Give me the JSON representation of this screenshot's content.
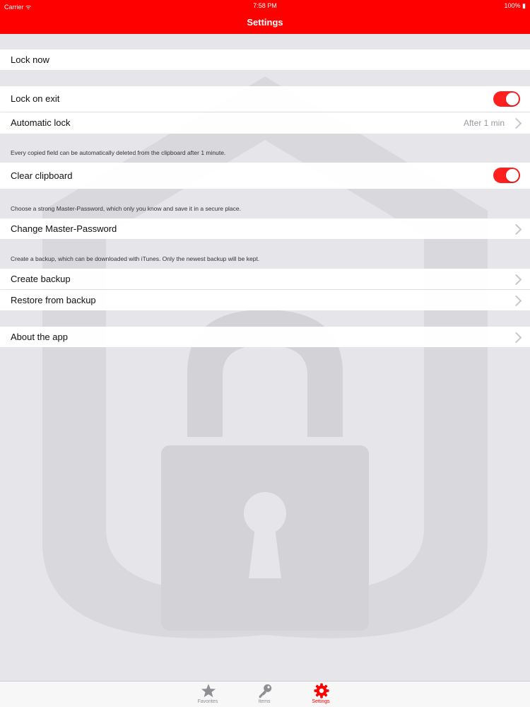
{
  "status_bar": {
    "carrier": "Carrier ᯤ",
    "time": "7:58 PM",
    "battery": "100% ▮"
  },
  "nav": {
    "title": "Settings"
  },
  "settings": {
    "lock_now": "Lock now",
    "lock_on_exit": {
      "label": "Lock on exit",
      "on": true
    },
    "automatic_lock": {
      "label": "Automatic lock",
      "value": "After 1 min"
    },
    "clipboard_note": "Every copied field can be automatically deleted from the clipboard after 1 minute.",
    "clear_clipboard": {
      "label": "Clear clipboard",
      "on": true
    },
    "password_note": "Choose a strong Master-Password, which only you know and save it in a secure place.",
    "change_master_password": "Change Master-Password",
    "backup_note": "Create a backup, which can be downloaded with iTunes. Only the newest backup will be kept.",
    "create_backup": "Create backup",
    "restore_backup": "Restore from backup",
    "about": "About the app"
  },
  "tab_bar": {
    "tabs": [
      {
        "label": "Favorites",
        "icon": "star-icon",
        "active": false
      },
      {
        "label": "Items",
        "icon": "key-icon",
        "active": false
      },
      {
        "label": "Settings",
        "icon": "gear-icon",
        "active": true
      }
    ]
  },
  "colors": {
    "accent": "#ff0000",
    "background": "#e6e5ea",
    "watermark": "#d6d5da"
  }
}
